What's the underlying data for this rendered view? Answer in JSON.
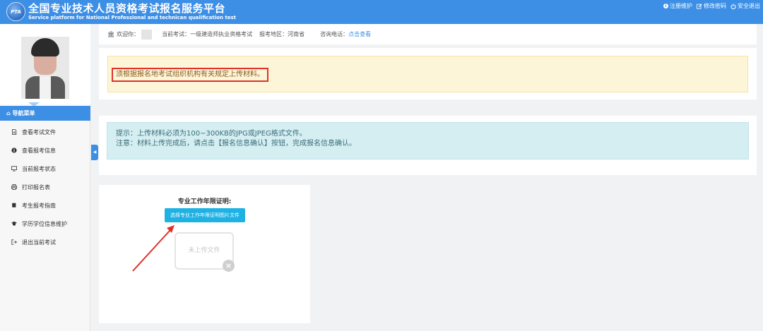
{
  "header": {
    "logo_text": "PTA",
    "title": "全国专业技术人员资格考试报名服务平台",
    "subtitle": "Service platform for National Professional and technican qualification test",
    "links": [
      {
        "label": "注册维护",
        "icon": "info-icon"
      },
      {
        "label": "修改密码",
        "icon": "edit-icon"
      },
      {
        "label": "安全退出",
        "icon": "power-icon"
      }
    ]
  },
  "sidebar": {
    "nav_header": "导航菜单",
    "items": [
      {
        "label": "查看考试文件",
        "icon": "file-icon"
      },
      {
        "label": "查看报考信息",
        "icon": "info-icon"
      },
      {
        "label": "当前报考状态",
        "icon": "monitor-icon"
      },
      {
        "label": "打印报名表",
        "icon": "print-icon"
      },
      {
        "label": "考生报考指南",
        "icon": "book-icon"
      },
      {
        "label": "学历学位信息维护",
        "icon": "graduation-cap-icon"
      },
      {
        "label": "退出当前考试",
        "icon": "sign-out-icon"
      }
    ]
  },
  "info_bar": {
    "welcome_label": "欢迎你：",
    "exam_label": "当前考试：",
    "exam_value": "一级建造师执业资格考试",
    "region_label": "报考地区：",
    "region_value": "河南省",
    "phone_label": "咨询电话：",
    "phone_link": "点击查看"
  },
  "warning": {
    "text": "须根据报名地考试组织机构有关规定上传材料。"
  },
  "tips": {
    "line1": "提示：上传材料必须为100~300KB的JPG或JPEG格式文件。",
    "line2": "注意：材料上传完成后，请点击【报名信息确认】按钮，完成报名信息确认。"
  },
  "upload": {
    "title": "专业工作年限证明:",
    "button_label": "选择专业工作年限证明图片文件",
    "preview_placeholder": "未上传文件"
  },
  "colors": {
    "primary": "#3d8fe6",
    "upload_button": "#1db1e4",
    "warning_bg": "#fdf5d8",
    "tip_bg": "#d5eef1",
    "highlight_border": "#e0312b"
  }
}
